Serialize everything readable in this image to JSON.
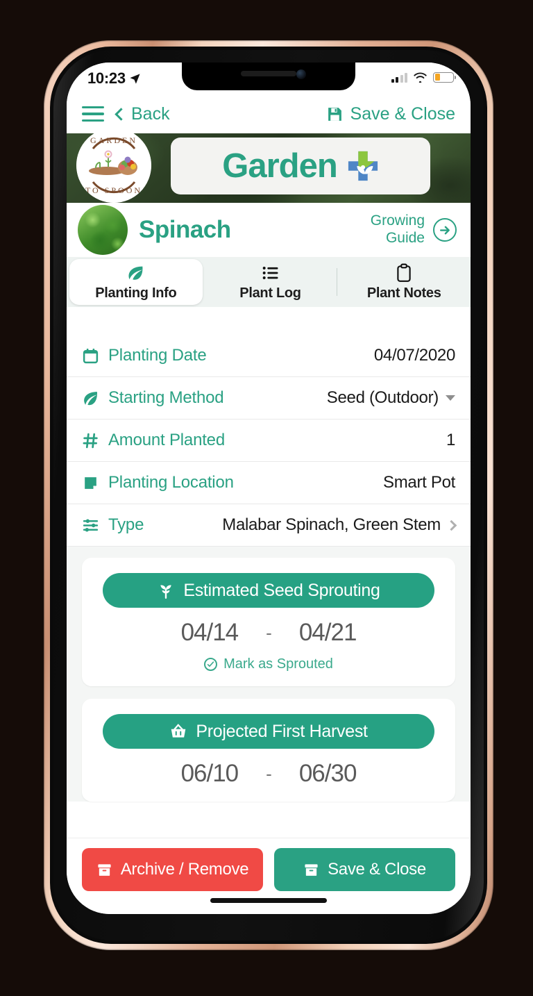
{
  "status_bar": {
    "time": "10:23",
    "location_icon": "location-arrow-icon",
    "signal_icon": "cellular-signal-icon",
    "signal_bars_filled": 2,
    "wifi_icon": "wifi-icon",
    "battery_icon": "battery-low-icon",
    "battery_level_pct": 28,
    "battery_color": "#f5a623"
  },
  "navbar": {
    "menu_icon": "hamburger-menu-icon",
    "back_label": "Back",
    "back_icon": "chevron-left-icon",
    "save_label": "Save & Close",
    "save_icon": "save-disk-icon"
  },
  "hero": {
    "logo_alt": "Garden To Spoon logo",
    "logo_text_top": "GARDEN",
    "logo_text_bottom": "TO SPOON",
    "title": "Garden",
    "badge_icon": "plant-plus-badge-icon"
  },
  "plant": {
    "name": "Spinach",
    "thumb_icon": "spinach-photo-thumbnail",
    "growing_guide_line1": "Growing",
    "growing_guide_line2": "Guide",
    "growing_guide_arrow": "arrow-right-circle-icon"
  },
  "tabs": [
    {
      "label": "Planting Info",
      "icon": "leaf-icon",
      "active": true
    },
    {
      "label": "Plant Log",
      "icon": "list-icon",
      "active": false
    },
    {
      "label": "Plant Notes",
      "icon": "clipboard-icon",
      "active": false
    }
  ],
  "fields": [
    {
      "label": "Planting Date",
      "value": "04/07/2020",
      "icon": "calendar-icon",
      "control": "none"
    },
    {
      "label": "Starting Method",
      "value": "Seed (Outdoor)",
      "icon": "leaf-icon",
      "control": "dropdown"
    },
    {
      "label": "Amount Planted",
      "value": "1",
      "icon": "hash-icon",
      "control": "none"
    },
    {
      "label": "Planting Location",
      "value": "Smart Pot",
      "icon": "note-icon",
      "control": "none"
    },
    {
      "label": "Type",
      "value": "Malabar Spinach, Green Stem",
      "icon": "sliders-icon",
      "control": "chevron"
    }
  ],
  "cards": [
    {
      "title": "Estimated Seed Sprouting",
      "icon": "sprout-icon",
      "date_start": "04/14",
      "date_sep": "-",
      "date_end": "04/21",
      "action_label": "Mark as Sprouted",
      "action_icon": "check-circle-icon"
    },
    {
      "title": "Projected First Harvest",
      "icon": "basket-icon",
      "date_start": "06/10",
      "date_sep": "-",
      "date_end": "06/30",
      "action_label": "",
      "action_icon": ""
    }
  ],
  "footer": {
    "archive_label": "Archive / Remove",
    "archive_icon": "archive-box-icon",
    "save_label": "Save & Close",
    "save_icon": "archive-box-icon"
  },
  "colors": {
    "brand_green": "#2aa183",
    "pill_green": "#26a183",
    "danger_red": "#f04a45",
    "tabbar_bg": "#eef3f1",
    "page_bg": "#f4f6f5"
  }
}
